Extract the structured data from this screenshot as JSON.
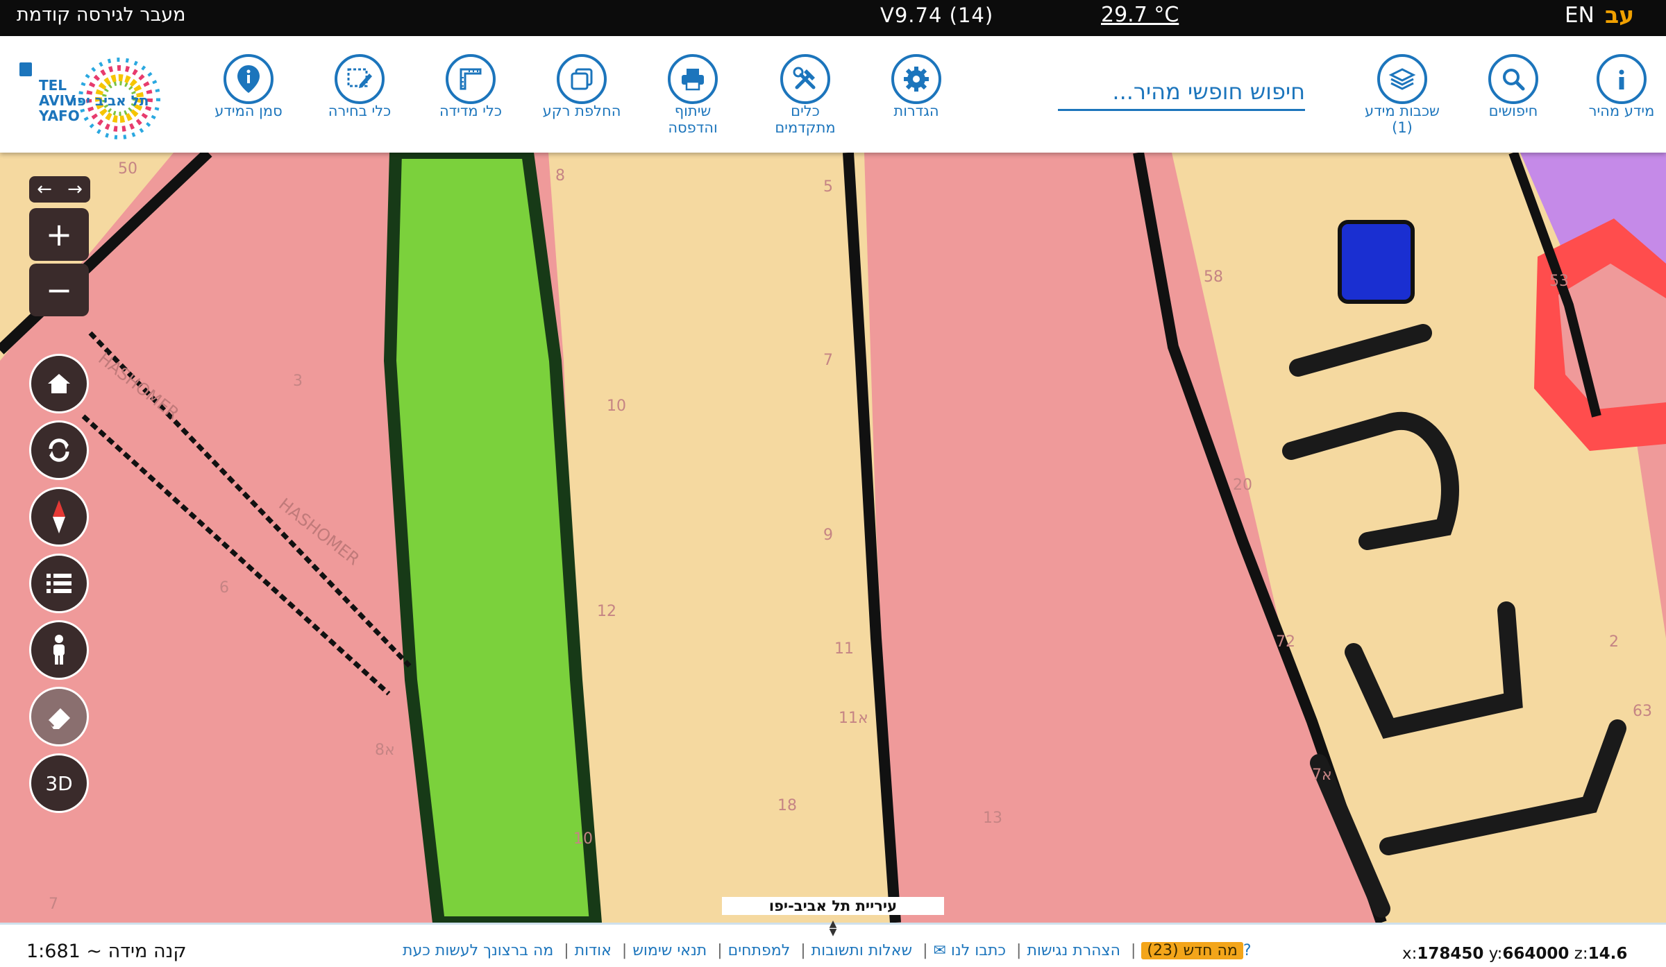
{
  "topbar": {
    "prev_version": "מעבר לגירסה קודמת",
    "version": "V9.74 (14)",
    "temperature": "29.7 °C",
    "lang_en": "EN",
    "lang_he": "עב"
  },
  "toolbar": {
    "quick_info": "מידע מהיר",
    "searches": "חיפושים",
    "layers": "שכבות מידע",
    "layers_count": "(1)",
    "search_placeholder": "חיפוש חופשי מהיר...",
    "settings": "הגדרות",
    "advanced_tools_1": "כלים",
    "advanced_tools_2": "מתקדמים",
    "share_print_1": "שיתוף",
    "share_print_2": "והדפסה",
    "basemap": "החלפת רקע",
    "measure": "כלי מדידה",
    "select": "כלי בחירה",
    "info_marker": "סמן המידע"
  },
  "logo": {
    "he": "תל אביב יפו",
    "en_1": "TEL",
    "en_2": "AVIV",
    "en_3": "YAFO"
  },
  "map": {
    "city_label": "עיריית תל אביב-יפו",
    "street_1": "HASHOMER",
    "street_2": "HASHOMER",
    "ctrl_3d": "3D",
    "parcel_numbers": [
      "50",
      "8",
      "5",
      "3",
      "7",
      "10",
      "58",
      "53",
      "6",
      "12",
      "9",
      "11",
      "8א",
      "11א",
      "72",
      "2",
      "63",
      "7א",
      "7",
      "10",
      "18",
      "13",
      "20"
    ]
  },
  "bottombar": {
    "scale": "קנה מידה ~ 1:681",
    "links": {
      "whats_new": "מה חדש (23)",
      "accessibility": "הצהרת נגישות",
      "contact": "כתבו לנו ✉",
      "faq": "שאלות ותשובות",
      "developers": "למפתחים",
      "terms": "תנאי שימוש",
      "about": "אודות",
      "what_now": "מה ברצונך לעשות כעת?"
    },
    "coords": {
      "x_label": "x:",
      "x": "178450",
      "y_label": "y:",
      "y": "664000",
      "z_label": "z:",
      "z": "14.6"
    }
  },
  "colors": {
    "accent": "#1c75bc",
    "residential_pink": "#ef9a9a",
    "residential_yellow": "#f5d9a0",
    "green_space": "#7bd13c",
    "purple_zone": "#c58ae8",
    "red_zone": "#ff4d4d",
    "blue_feature": "#1a2fd1"
  }
}
